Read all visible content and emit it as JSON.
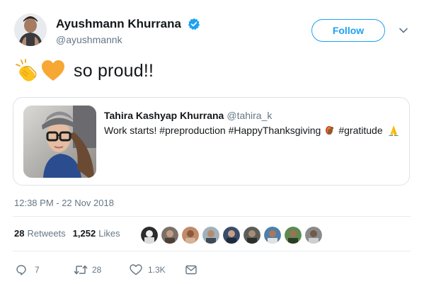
{
  "author": {
    "name": "Ayushmann Khurrana",
    "handle": "@ayushmannk",
    "verified": true
  },
  "follow_label": "Follow",
  "tweet": {
    "emojis": [
      "clapping-hands-emoji",
      "orange-heart-emoji"
    ],
    "text": "so proud!!"
  },
  "quoted_tweet": {
    "name": "Tahira Kashyap Khurrana",
    "handle": "@tahira_k",
    "text": "Work starts! #preproduction #HappyThanksgiving",
    "text_after": "#gratitude",
    "inline_emojis": [
      "turkey-emoji",
      "folded-hands-emoji"
    ]
  },
  "timestamp": "12:38 PM - 22 Nov 2018",
  "stats": {
    "retweets_count": "28",
    "retweets_label": "Retweets",
    "likes_count": "1,252",
    "likes_label": "Likes"
  },
  "liker_avatars": 9,
  "actions": {
    "replies": "7",
    "retweets": "28",
    "likes": "1.3K"
  },
  "colors": {
    "accent": "#1da1f2",
    "text": "#14171a",
    "muted": "#657786",
    "border": "#e6ecf0"
  }
}
